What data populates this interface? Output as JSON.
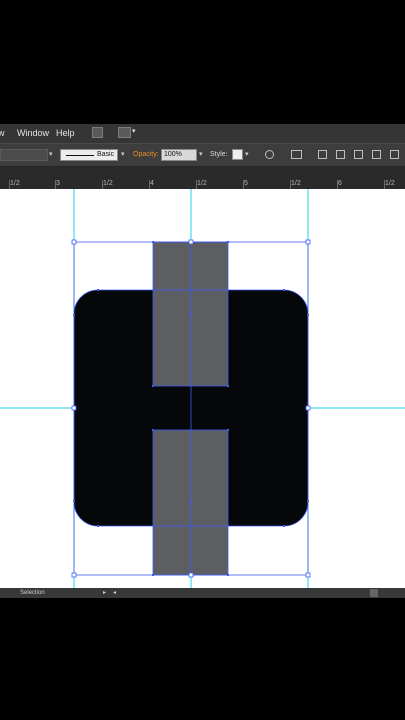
{
  "menu": {
    "partial": "w",
    "window": "Window",
    "help": "Help"
  },
  "options": {
    "stroke_profile": "Basic",
    "opacity_label": "Opacity:",
    "opacity_value": "100%",
    "style_label": "Style:"
  },
  "ruler": {
    "labels": [
      "1/2",
      "3",
      "1/2",
      "4",
      "1/2",
      "5",
      "1/2",
      "6",
      "1/2"
    ]
  },
  "status": {
    "tool": "Selection"
  },
  "colors": {
    "shape_fill": "#050708",
    "bar_fill": "#5d5e61",
    "guide": "#22d3e6",
    "selection": "#3d5cf0"
  },
  "icons": [
    "bridge-icon",
    "arrange-documents-icon",
    "recolor-icon",
    "align-icons",
    "transform-icons"
  ]
}
